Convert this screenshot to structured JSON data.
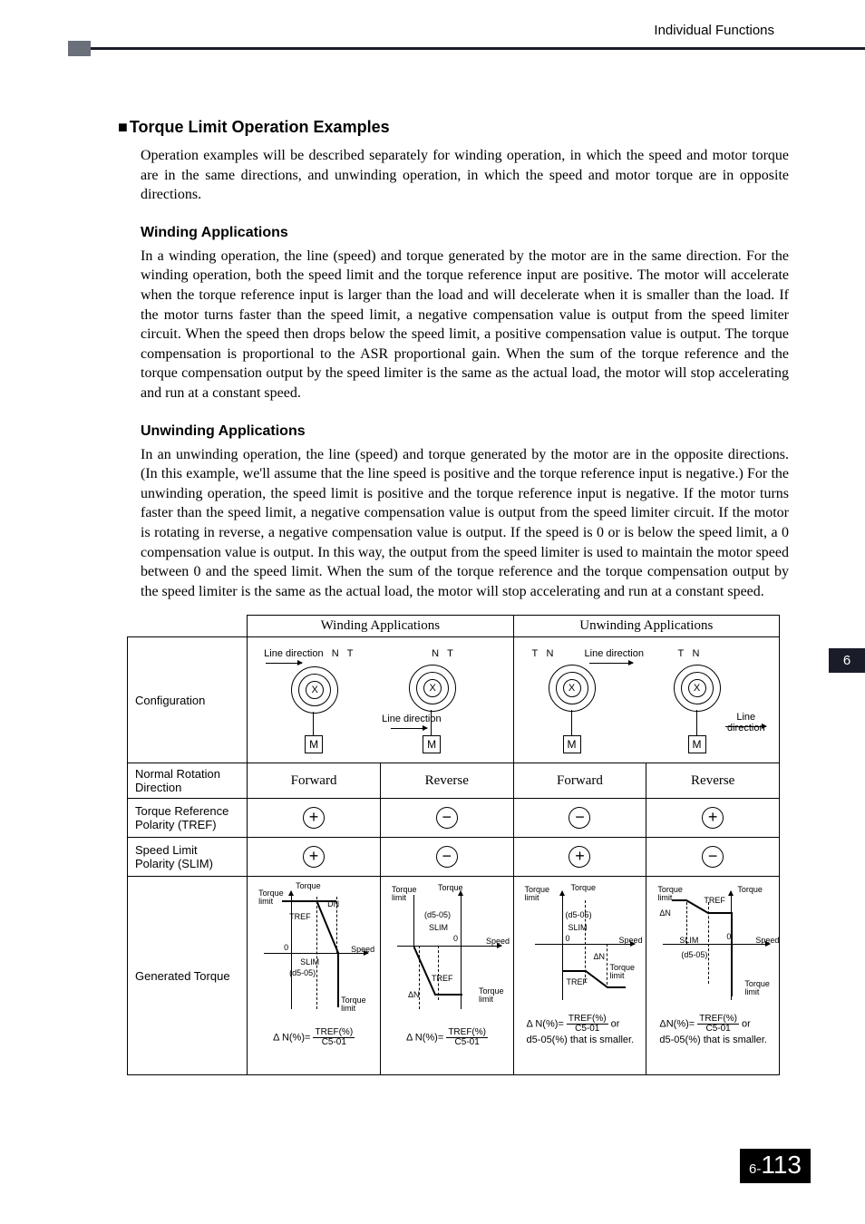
{
  "header": {
    "label": "Individual Functions"
  },
  "section": {
    "title": "Torque Limit Operation Examples",
    "intro": "Operation examples will be described separately for winding operation, in which the speed and motor torque are in the same directions, and unwinding operation, in which the speed and motor torque are in opposite directions."
  },
  "winding": {
    "title": "Winding Applications",
    "text": "In a winding operation, the line (speed) and torque generated by the motor are in the same direction. For the winding operation, both the speed limit and the torque reference input are positive. The motor will accelerate when the torque reference input is larger than the load and will decelerate when it is smaller than the load. If the motor turns faster than the speed limit, a negative compensation value is output from the speed limiter circuit. When the speed then drops below the speed limit, a positive compensation value is output. The torque compensation is proportional to the ASR proportional gain. When the sum of the torque reference and the torque compensation output by the speed limiter is the same as the actual load, the motor will stop accelerating and run at a constant speed."
  },
  "unwinding": {
    "title": "Unwinding Applications",
    "text": "In an unwinding operation, the line (speed) and torque generated by the motor are in the opposite directions. (In this example, we'll assume that the line speed is positive and the torque reference input is negative.) For the unwinding operation, the speed limit is positive and the torque reference input is negative. If the motor turns faster than the speed limit, a negative compensation value is output from the speed limiter circuit. If the motor is rotating in reverse, a negative compensation value is output. If the speed is 0 or is below the speed limit, a 0 compensation value is output. In this way, the output from the speed limiter is used to maintain the motor speed between 0 and the speed limit. When the sum of the torque reference and the torque compensation output by the speed limiter is the same as the actual load, the motor will stop accelerating and run at a constant speed."
  },
  "table": {
    "col_w": "Winding Applications",
    "col_u": "Unwinding Applications",
    "row_config": "Configuration",
    "row_rotation": "Normal Rotation Direction",
    "row_tref": "Torque Reference Polarity (TREF)",
    "row_slim": "Speed Limit Polarity (SLIM)",
    "row_gentq": "Generated Torque",
    "rot_fwd": "Forward",
    "rot_rev": "Reverse",
    "plus": "+",
    "minus": "−",
    "cfg_labels": {
      "line_dir": "Line direction",
      "N": "N",
      "T": "T",
      "X": "X",
      "M": "M"
    },
    "gen_labels": {
      "torque": "Torque",
      "torque_limit": "Torque\nlimit",
      "speed": "Speed",
      "tref": "TREF",
      "slim": "SLIM",
      "d505": "(d5-05)",
      "zero": "0",
      "dn_up": "DN",
      "dn": "ΔN",
      "tlim_low": "Torque\nlimit"
    },
    "formula": {
      "lhs": "Δ N(%)=",
      "lhs2": "ΔN(%)=",
      "num": "TREF(%)",
      "den": "C5-01",
      "or": "or",
      "tail": "d5-05(%) that is smaller."
    }
  },
  "sidetab": "6",
  "footer": {
    "chapter": "6-",
    "page": "113"
  },
  "chart_data": {
    "type": "table",
    "title": "Torque Limit Operation Examples — Winding vs Unwinding",
    "columns": [
      "",
      "Winding Applications",
      "",
      "Unwinding Applications",
      ""
    ],
    "rows": [
      {
        "label": "Normal Rotation Direction",
        "cells": [
          "Forward",
          "Reverse",
          "Forward",
          "Reverse"
        ]
      },
      {
        "label": "Torque Reference Polarity (TREF)",
        "cells": [
          "+",
          "−",
          "−",
          "+"
        ]
      },
      {
        "label": "Speed Limit Polarity (SLIM)",
        "cells": [
          "+",
          "−",
          "+",
          "−"
        ]
      }
    ],
    "generated_torque": {
      "axes": {
        "x": "Speed",
        "y": "Torque"
      },
      "series_labels": [
        "TREF",
        "SLIM",
        "(d5-05)",
        "Torque limit",
        "ΔN"
      ],
      "formulas": [
        "ΔN(%) = TREF(%) / C5-01",
        "ΔN(%) = TREF(%) / C5-01",
        "ΔN(%) = TREF(%) / C5-01 or d5-05(%) that is smaller.",
        "ΔN(%) = TREF(%) / C5-01 or d5-05(%) that is smaller."
      ]
    }
  }
}
